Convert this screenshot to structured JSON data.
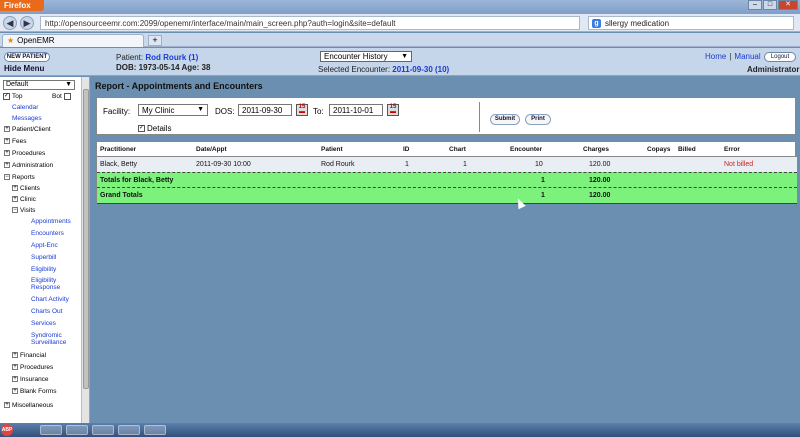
{
  "browser": {
    "app_button": "Firefox",
    "url": "http://opensourceemr.com:2099/openemr/interface/main/main_screen.php?auth=login&site=default",
    "url_domain": "opensourceemr.com",
    "search_query": "sllergy medication",
    "tab_title": "OpenEMR",
    "new_tab": "+"
  },
  "header": {
    "new_patient": "NEW PATIENT",
    "hide_menu": "Hide Menu",
    "patient_label": "Patient:",
    "patient_name": "Rod Rourk (1)",
    "dob_line": "DOB: 1973-05-14 Age: 38",
    "encounter_select": "Encounter History",
    "selected_encounter_label": "Selected Encounter:",
    "selected_encounter": "2011-09-30 (10)",
    "home": "Home",
    "manual": "Manual",
    "logout": "Logout",
    "user": "Administrator"
  },
  "sidebar": {
    "select_value": "Default",
    "top_label": "Top",
    "bot_label": "Bot",
    "items": {
      "calendar": "Calendar",
      "messages": "Messages",
      "patient_client": "Patient/Client",
      "fees": "Fees",
      "procedures": "Procedures",
      "administration": "Administration",
      "reports": "Reports",
      "clients": "Clients",
      "clinic": "Clinic",
      "visits": "Visits",
      "appointments": "Appointments",
      "encounters": "Encounters",
      "appt_enc": "Appt-Enc",
      "superbill": "Superbill",
      "eligibility": "Eligibility",
      "eligibility_response_1": "Eligibility",
      "eligibility_response_2": "Response",
      "chart_activity": "Chart Activity",
      "charts_out": "Charts Out",
      "services": "Services",
      "syndromic_1": "Syndromic",
      "syndromic_2": "Surveillance",
      "financial": "Financial",
      "procedures2": "Procedures",
      "insurance": "Insurance",
      "blank_forms": "Blank Forms",
      "miscellaneous": "Miscellaneous"
    }
  },
  "report": {
    "title": "Report - Appointments and Encounters",
    "facility_label": "Facility:",
    "facility_value": "My Clinic",
    "dos_label": "DOS:",
    "dos_from": "2011-09-30",
    "to_label": "To:",
    "dos_to": "2011-10-01",
    "details_label": "Details",
    "submit": "Submit",
    "print": "Print",
    "columns": {
      "practitioner": "Practitioner",
      "date": "Date/Appt",
      "patient": "Patient",
      "id": "ID",
      "chart": "Chart",
      "encounter": "Encounter",
      "charges": "Charges",
      "copays": "Copays",
      "billed": "Billed",
      "error": "Error"
    },
    "row": {
      "practitioner": "Black, Betty",
      "date": "2011-09-30 10:00",
      "patient": "Rod Rourk",
      "id": "1",
      "chart": "1",
      "encounter": "10",
      "charges": "120.00",
      "error": "Not billed"
    },
    "totals_label": "Totals for Black, Betty",
    "totals_encounter": "1",
    "totals_charges": "120.00",
    "grand_label": "Grand Totals",
    "grand_encounter": "1",
    "grand_charges": "120.00"
  },
  "colors": {
    "total_row": "#7cf27c",
    "link": "#1a3bd1",
    "error_text": "#cc2222",
    "main_bg": "#6a8fb0"
  }
}
